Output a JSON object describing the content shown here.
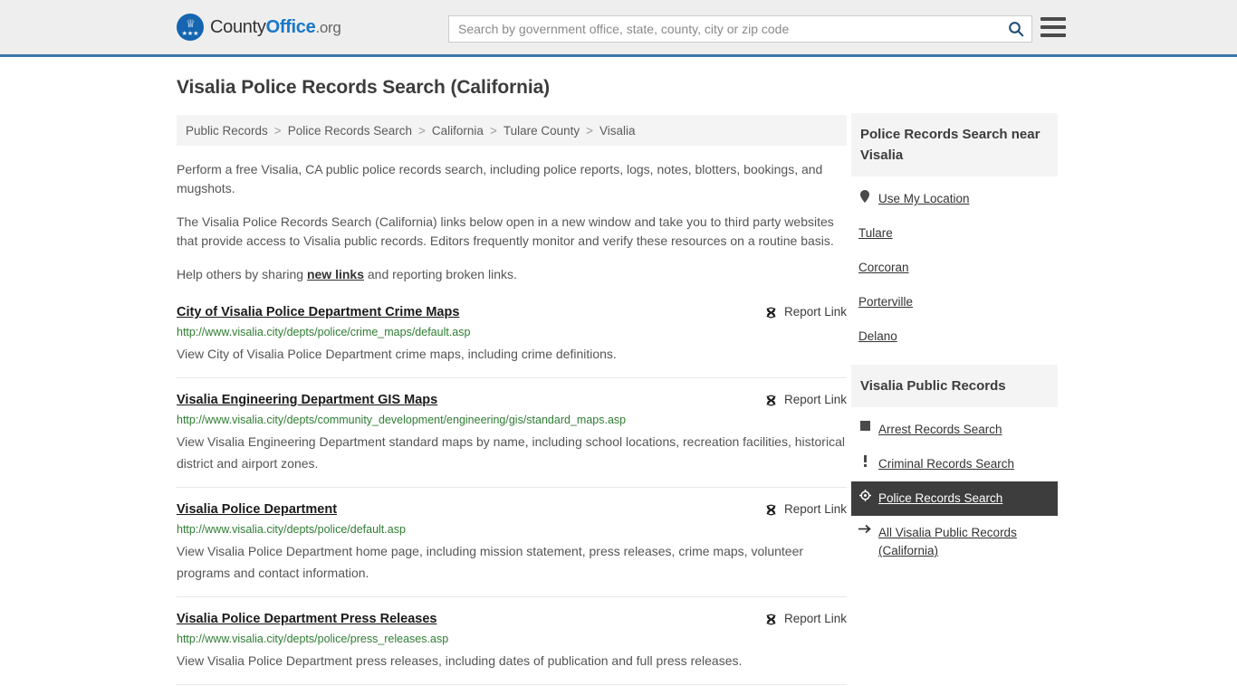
{
  "header": {
    "logo": {
      "word1": "County",
      "word2": "Office",
      "tld": ".org",
      "emblem_icon": "eagle-shield-icon",
      "brand_color": "#1877c9"
    },
    "search": {
      "placeholder": "Search by government office, state, county, city or zip code",
      "value": "",
      "icon": "search-icon"
    },
    "menu_icon": "hamburger-menu-icon",
    "accent_color": "#3a76a8"
  },
  "main": {
    "title": "Visalia Police Records Search (California)",
    "breadcrumb": [
      {
        "label": "Public Records"
      },
      {
        "label": "Police Records Search"
      },
      {
        "label": "California"
      },
      {
        "label": "Tulare County"
      },
      {
        "label": "Visalia"
      }
    ],
    "breadcrumb_separator": ">",
    "intro": {
      "p1": "Perform a free Visalia, CA public police records search, including police reports, logs, notes, blotters, bookings, and mugshots.",
      "p2": "The Visalia Police Records Search (California) links below open in a new window and take you to third party websites that provide access to Visalia public records. Editors frequently monitor and verify these resources on a routine basis.",
      "p3_before": "Help others by sharing ",
      "p3_link": "new links",
      "p3_after": " and reporting broken links."
    },
    "report_link_label": "Report Link",
    "report_link_icon": "broken-link-icon",
    "results": [
      {
        "title": "City of Visalia Police Department Crime Maps",
        "url": "http://www.visalia.city/depts/police/crime_maps/default.asp",
        "description": "View City of Visalia Police Department crime maps, including crime definitions."
      },
      {
        "title": "Visalia Engineering Department GIS Maps",
        "url": "http://www.visalia.city/depts/community_development/engineering/gis/standard_maps.asp",
        "description": "View Visalia Engineering Department standard maps by name, including school locations, recreation facilities, historical district and airport zones."
      },
      {
        "title": "Visalia Police Department",
        "url": "http://www.visalia.city/depts/police/default.asp",
        "description": "View Visalia Police Department home page, including mission statement, press releases, crime maps, volunteer programs and contact information."
      },
      {
        "title": "Visalia Police Department Press Releases",
        "url": "http://www.visalia.city/depts/police/press_releases.asp",
        "description": "View Visalia Police Department press releases, including dates of publication and full press releases."
      }
    ]
  },
  "sidebar": {
    "nearby": {
      "heading": "Police Records Search near Visalia",
      "items": [
        {
          "label": "Use My Location",
          "icon": "map-pin-icon"
        },
        {
          "label": "Tulare",
          "icon": ""
        },
        {
          "label": "Corcoran",
          "icon": ""
        },
        {
          "label": "Porterville",
          "icon": ""
        },
        {
          "label": "Delano",
          "icon": ""
        }
      ]
    },
    "public_records": {
      "heading": "Visalia Public Records",
      "items": [
        {
          "label": "Arrest Records Search",
          "icon": "square-icon",
          "active": false
        },
        {
          "label": "Criminal Records Search",
          "icon": "exclamation-icon",
          "active": false
        },
        {
          "label": "Police Records Search",
          "icon": "target-icon",
          "active": true
        },
        {
          "label": "All Visalia Public Records (California)",
          "icon": "arrow-right-icon",
          "active": false
        }
      ],
      "active_bg": "#3d3d3d"
    }
  }
}
